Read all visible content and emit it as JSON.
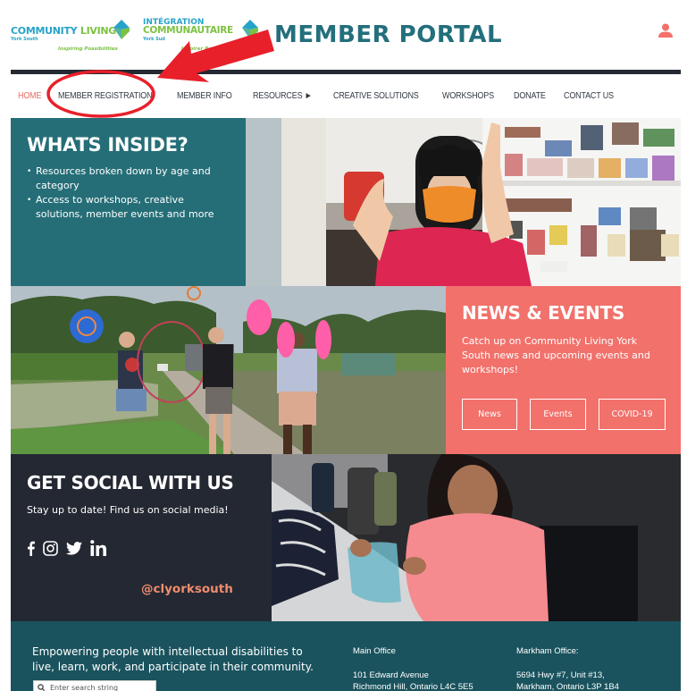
{
  "header": {
    "logo_en": {
      "word1": "COMMUNITY",
      "word2": "LIVING",
      "sub": "York South",
      "tagline": "Inspiring Possibilities"
    },
    "logo_fr": {
      "top": "INTÉGRATION",
      "big": "COMMUNAUTAIRE",
      "sub": "York Sud",
      "tagline": "Inspirer Possibilités"
    },
    "title": "MEMBER PORTAL",
    "user_icon": "user-icon"
  },
  "nav": {
    "items": [
      {
        "label": "HOME",
        "active": true
      },
      {
        "label": "MEMBER REGISTRATION"
      },
      {
        "label": "MEMBER INFO"
      },
      {
        "label": "RESOURCES ►"
      },
      {
        "label": "CREATIVE SOLUTIONS"
      },
      {
        "label": "WORKSHOPS"
      },
      {
        "label": "DONATE"
      },
      {
        "label": "CONTACT US"
      }
    ]
  },
  "whats_inside": {
    "title": "WHATS INSIDE?",
    "bullets": [
      "Resources broken down by age and category",
      "Access to workshops, creative solutions, member events and more"
    ]
  },
  "news_events": {
    "title": "NEWS & EVENTS",
    "text": "Catch up on Community Living York South news and upcoming events and workshops!",
    "buttons": [
      "News",
      "Events",
      "COVID-19"
    ]
  },
  "social": {
    "title": "GET SOCIAL WITH US",
    "text": "Stay up to date! Find us on social media!",
    "icons": [
      "facebook-icon",
      "instagram-icon",
      "twitter-icon",
      "linkedin-icon"
    ],
    "handle": "@clyorksouth"
  },
  "footer": {
    "mission": "Empowering people with intellectual disabilities to live, learn, work, and participate in their community.",
    "search_placeholder": "Enter search string",
    "main_office": {
      "label": "Main Office",
      "line1": "101 Edward Avenue",
      "line2": "Richmond Hill, Ontario L4C 5E5"
    },
    "markham_office": {
      "label": "Markham Office:",
      "line1": "5694 Hwy #7, Unit #13,",
      "line2": "Markham, Ontario L3P 1B4"
    }
  },
  "colors": {
    "teal": "#256e77",
    "coral": "#f2716b",
    "dark": "#242832",
    "footer": "#1a535e",
    "title": "#236f7c",
    "nav_active": "#ea6b66",
    "annotation_red": "#e8202a"
  }
}
